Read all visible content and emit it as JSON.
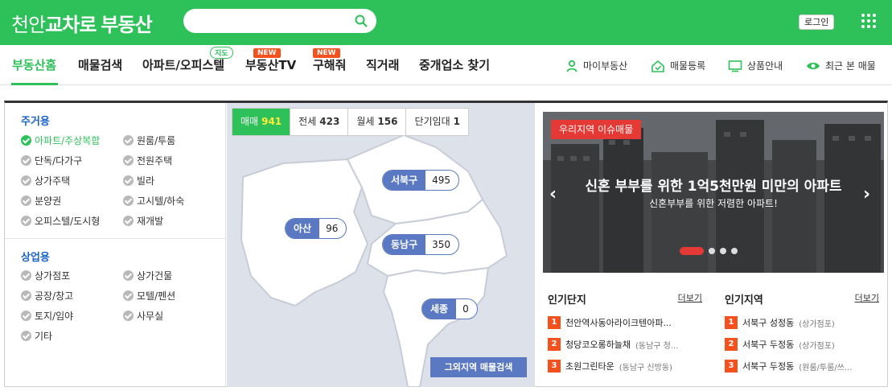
{
  "brand": {
    "part1": "천안",
    "part2": "교차로",
    "part3": "부동산"
  },
  "header": {
    "search_placeholder": "",
    "login_label": "로그인"
  },
  "nav": {
    "items": [
      {
        "label": "부동산홈",
        "active": true
      },
      {
        "label": "매물검색"
      },
      {
        "label": "아파트/오피스텔",
        "badge": "지도"
      },
      {
        "label": "부동산TV",
        "badge": "NEW"
      },
      {
        "label": "구해줘",
        "badge": "NEW"
      },
      {
        "label": "직거래"
      },
      {
        "label": "중개업소 찾기"
      }
    ],
    "utils": [
      {
        "label": "마이부동산",
        "icon": "person-icon"
      },
      {
        "label": "매물등록",
        "icon": "house-check-icon"
      },
      {
        "label": "상품안내",
        "icon": "monitor-icon"
      },
      {
        "label": "최근 본 매물",
        "icon": "eye-icon"
      }
    ]
  },
  "filters": {
    "residential": {
      "title": "주거용",
      "items": [
        "아파트/주상복합",
        "원룸/투룸",
        "단독/다가구",
        "전원주택",
        "상가주택",
        "빌라",
        "분양권",
        "고시텔/하숙",
        "오피스텔/도시형",
        "재개발"
      ],
      "selected": "아파트/주상복합"
    },
    "commercial": {
      "title": "상업용",
      "items": [
        "상가점포",
        "상가건물",
        "공장/창고",
        "모텔/펜션",
        "토지/임야",
        "사무실",
        "기타"
      ]
    }
  },
  "map": {
    "tabs": [
      {
        "label": "매매",
        "count": "941",
        "active": true
      },
      {
        "label": "전세",
        "count": "423"
      },
      {
        "label": "월세",
        "count": "156"
      },
      {
        "label": "단기임대",
        "count": "1"
      }
    ],
    "regions": [
      {
        "name": "서북구",
        "count": "495"
      },
      {
        "name": "아산",
        "count": "96"
      },
      {
        "name": "동남구",
        "count": "350"
      },
      {
        "name": "세종",
        "count": "0"
      }
    ],
    "other_region_button": "그외지역 매물검색"
  },
  "banner": {
    "tag": "우리지역 이슈매물",
    "title": "신혼 부부를 위한 1억5천만원 미만의 아파트",
    "subtitle": "신혼부부를 위한 저렴한 아파트!",
    "prev": "‹",
    "next": "›",
    "slides": 4,
    "active_slide": 1
  },
  "popular_complex": {
    "title": "인기단지",
    "more": "더보기",
    "rows": [
      {
        "rank": "1",
        "name": "천안역사동아라이크텐아파...",
        "sub": ""
      },
      {
        "rank": "2",
        "name": "청당코오롱하늘채",
        "sub": "(동남구 청..."
      },
      {
        "rank": "3",
        "name": "초원그린타운",
        "sub": "(동남구 신방동)"
      }
    ]
  },
  "popular_region": {
    "title": "인기지역",
    "more": "더보기",
    "rows": [
      {
        "rank": "1",
        "name": "서북구 성정동",
        "sub": "(상가점포)"
      },
      {
        "rank": "2",
        "name": "서북구 두정동",
        "sub": "(상가점포)"
      },
      {
        "rank": "3",
        "name": "서북구 두정동",
        "sub": "(원룸/투룸/쓰..."
      }
    ]
  },
  "colors": {
    "brand_green": "#2ec15a",
    "region_blue": "#5a79c2",
    "accent_red": "#e53935",
    "rank_orange": "#f4511e"
  }
}
